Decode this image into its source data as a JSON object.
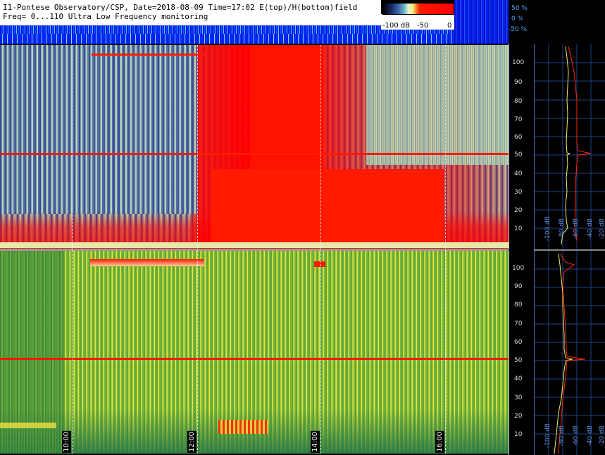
{
  "header": {
    "title_line1": "I1-Pontese Observatory/CSP, Date=2018-08-09 Time=17:02 E(top)/H(bottom)field",
    "title_line2": "Freq= 0...110 Ultra Low Frequency monitoring"
  },
  "colorbar": {
    "min_label": "-100 dB",
    "mid_label": "-50",
    "max_label": "0"
  },
  "percent_axis": [
    "50 %",
    "0 %",
    "-50 %"
  ],
  "time_axis": [
    "10:00",
    "12:00",
    "14:00",
    "16:00"
  ],
  "freq_axis_top": [
    "100",
    "90",
    "80",
    "70",
    "60",
    "50",
    "40",
    "30",
    "20",
    "10"
  ],
  "freq_axis_bottom": [
    "100",
    "90",
    "80",
    "70",
    "60",
    "50",
    "40",
    "30",
    "20",
    "10"
  ],
  "side_panel_top": {
    "db_labels": [
      "-100 dB",
      "-80 dB",
      "-60 dB",
      "-40 dB",
      "-20 dB"
    ]
  },
  "side_panel_bottom": {
    "db_labels": [
      "-100 dB",
      "-80 dB",
      "-60 dB",
      "-40 dB",
      "-20 dB"
    ]
  },
  "colors": {
    "signal_red": "#ff1a00",
    "spectrum_yellow": "#f0f060",
    "grid_blue": "#1f3f7f"
  }
}
